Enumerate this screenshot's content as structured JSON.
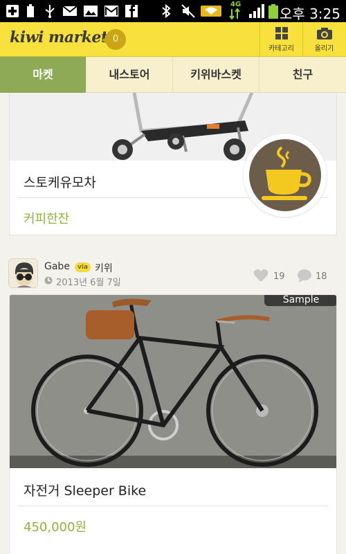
{
  "status_bar": {
    "network": "4G",
    "time": "오후 3:25"
  },
  "app_bar": {
    "logo": "kiwi market",
    "cart_count": "0",
    "category_label": "카테고리",
    "upload_label": "올리기"
  },
  "tabs": [
    {
      "label": "마켓",
      "active": true
    },
    {
      "label": "내스토어",
      "active": false
    },
    {
      "label": "키위바스켓",
      "active": false
    },
    {
      "label": "친구",
      "active": false
    }
  ],
  "posts": [
    {
      "title": "스토케유모차",
      "price": "커피한잔",
      "price_icon": "coffee-cup-icon"
    },
    {
      "user": "Gabe",
      "via_label": "via",
      "via_name": "키위",
      "date": "2013년 6월 7일",
      "likes": "19",
      "comments": "18",
      "tag": "Sample",
      "title": "자전거 Sleeper Bike",
      "price": "450,000원"
    }
  ],
  "colors": {
    "app_bar": "#f8e13c",
    "active_tab": "#8faa56",
    "price": "#8fb33a",
    "background": "#f4f2ec"
  }
}
